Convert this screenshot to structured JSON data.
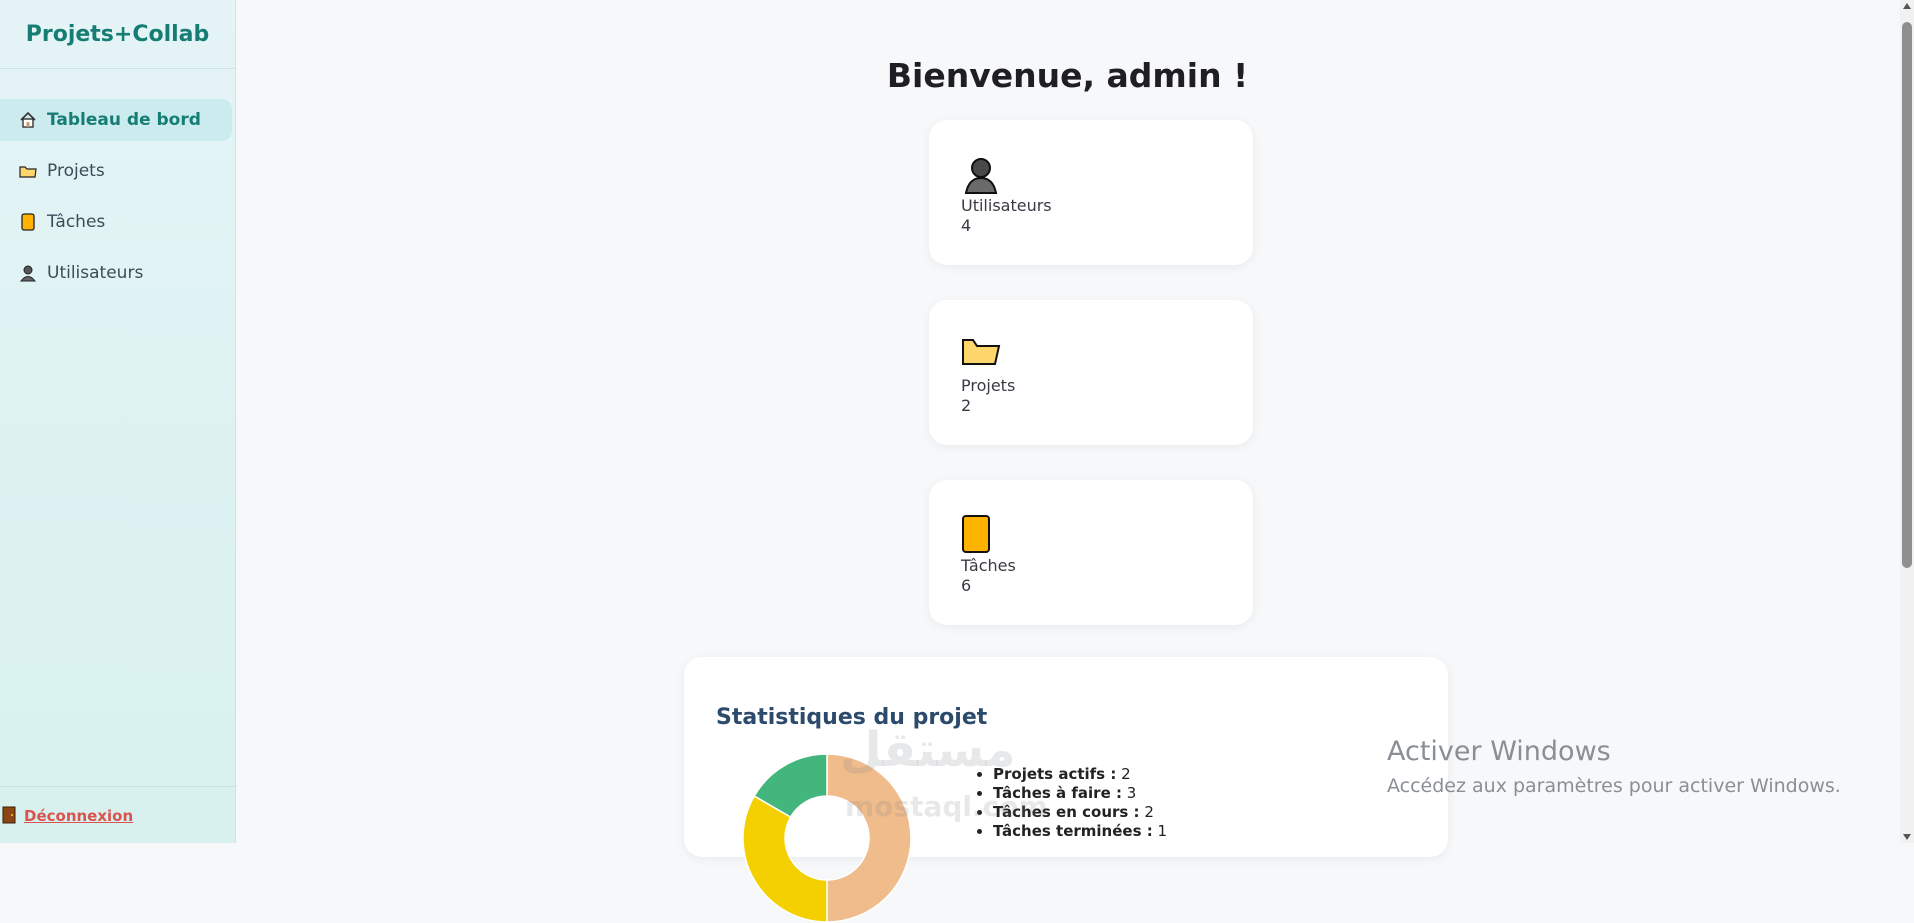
{
  "app": {
    "title": "Projets+Collab"
  },
  "sidebar": {
    "items": [
      {
        "label": "Tableau de bord",
        "icon": "house-icon",
        "active": true
      },
      {
        "label": "Projets",
        "icon": "folder-icon"
      },
      {
        "label": "Tâches",
        "icon": "task-card-icon"
      },
      {
        "label": "Utilisateurs",
        "icon": "user-icon"
      }
    ],
    "logout": {
      "label": "Déconnexion",
      "icon": "door-icon"
    }
  },
  "main": {
    "title": "Bienvenue, admin !",
    "cards": [
      {
        "label": "Utilisateurs",
        "value": "4",
        "icon": "user-icon"
      },
      {
        "label": "Projets",
        "value": "2",
        "icon": "folder-icon"
      },
      {
        "label": "Tâches",
        "value": "6",
        "icon": "task-card-icon"
      }
    ]
  },
  "stats": {
    "title": "Statistiques du projet",
    "items": [
      {
        "label": "Projets actifs :",
        "value": "2"
      },
      {
        "label": "Tâches à faire :",
        "value": "3"
      },
      {
        "label": "Tâches en cours :",
        "value": "2"
      },
      {
        "label": "Tâches terminées :",
        "value": "1"
      }
    ]
  },
  "chart_data": {
    "type": "pie",
    "labels": [],
    "values": [
      3,
      2,
      1
    ],
    "colors": [
      "#f0bc8c",
      "#f5d000",
      "#43b67d"
    ]
  },
  "watermark": {
    "text": "مستقل",
    "subtext": "mostaql.com"
  },
  "os_notice": {
    "title": "Activer Windows",
    "subtitle": "Accédez aux paramètres pour activer Windows."
  },
  "colors": {
    "accent": "#167d74",
    "logout": "#d9534f",
    "stats_title": "#2c4a6b"
  }
}
